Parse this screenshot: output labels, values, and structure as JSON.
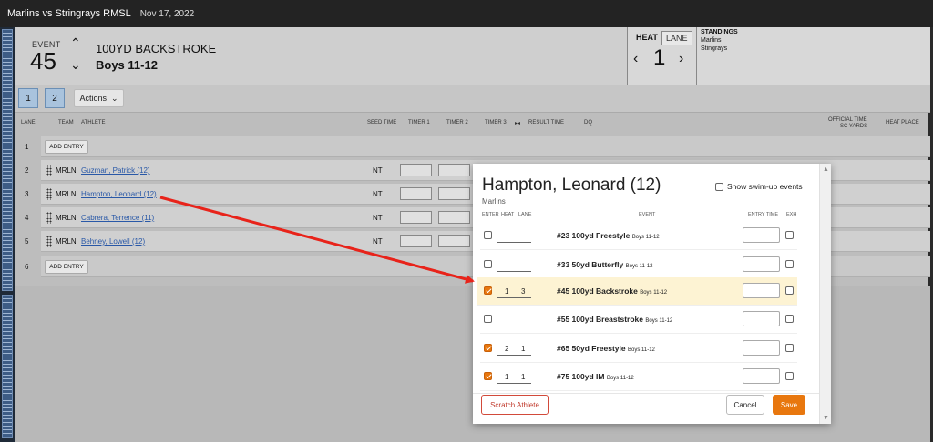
{
  "titlebar": {
    "title": "Marlins vs Stringrays RMSL",
    "date": "Nov 17, 2022"
  },
  "event": {
    "label": "EVENT",
    "number": "45",
    "name": "100YD BACKSTROKE",
    "group": "Boys 11-12",
    "up_icon": "chevron-up-icon",
    "down_icon": "chevron-down-icon"
  },
  "heat": {
    "tab_heat": "HEAT",
    "tab_lane": "LANE",
    "number": "1",
    "prev": "‹",
    "next": "›"
  },
  "standings": {
    "label": "STANDINGS",
    "teams": [
      "Marlins",
      "Stingrays"
    ]
  },
  "toolbar": {
    "heat_buttons": [
      "1",
      "2"
    ],
    "actions_label": "Actions",
    "actions_icon": "chevron-down-icon"
  },
  "columns": {
    "lane": "LANE",
    "team": "TEAM",
    "athlete": "ATHLETE",
    "seed": "SEED TIME",
    "timer1": "TIMER 1",
    "timer2": "TIMER 2",
    "timer3": "TIMER 3",
    "result": "RESULT TIME",
    "dq": "DQ",
    "official_1": "OFFICIAL TIME",
    "official_2": "SC YARDS",
    "place": "HEAT PLACE"
  },
  "lanes": {
    "add_label": "ADD ENTRY",
    "rows": [
      {
        "lane": "1",
        "type": "add"
      },
      {
        "lane": "2",
        "team": "MRLN",
        "athlete": "Guzman, Patrick (12)",
        "seed": "NT"
      },
      {
        "lane": "3",
        "team": "MRLN",
        "athlete": "Hampton, Leonard (12)",
        "seed": "NT"
      },
      {
        "lane": "4",
        "team": "MRLN",
        "athlete": "Cabrera, Terrence (11)",
        "seed": "NT"
      },
      {
        "lane": "5",
        "team": "MRLN",
        "athlete": "Behney, Lowell (12)",
        "seed": "NT"
      },
      {
        "lane": "6",
        "type": "add"
      }
    ]
  },
  "modal": {
    "title": "Hampton, Leonard (12)",
    "team": "Marlins",
    "show_swim_up": "Show swim-up events",
    "headers": {
      "enter": "ENTER",
      "heat": "HEAT",
      "lane": "LANE",
      "event": "EVENT",
      "entry_time": "ENTRY TIME",
      "exh": "EXH"
    },
    "events": [
      {
        "entered": false,
        "heat": "",
        "lane": "",
        "event": "#23 100yd Freestyle",
        "group": "Boys 11-12"
      },
      {
        "entered": false,
        "heat": "",
        "lane": "",
        "event": "#33 50yd Butterfly",
        "group": "Boys 11-12"
      },
      {
        "entered": true,
        "heat": "1",
        "lane": "3",
        "event": "#45 100yd Backstroke",
        "group": "Boys 11-12",
        "highlight": true
      },
      {
        "entered": false,
        "heat": "",
        "lane": "",
        "event": "#55 100yd Breaststroke",
        "group": "Boys 11-12"
      },
      {
        "entered": true,
        "heat": "2",
        "lane": "1",
        "event": "#65 50yd Freestyle",
        "group": "Boys 11-12"
      },
      {
        "entered": true,
        "heat": "1",
        "lane": "1",
        "event": "#75 100yd IM",
        "group": "Boys 11-12"
      }
    ],
    "scratch_label": "Scratch Athlete",
    "cancel_label": "Cancel",
    "save_label": "Save",
    "accent": "#e8770e"
  },
  "annotation": {
    "arrow_color": "#e8231a"
  }
}
